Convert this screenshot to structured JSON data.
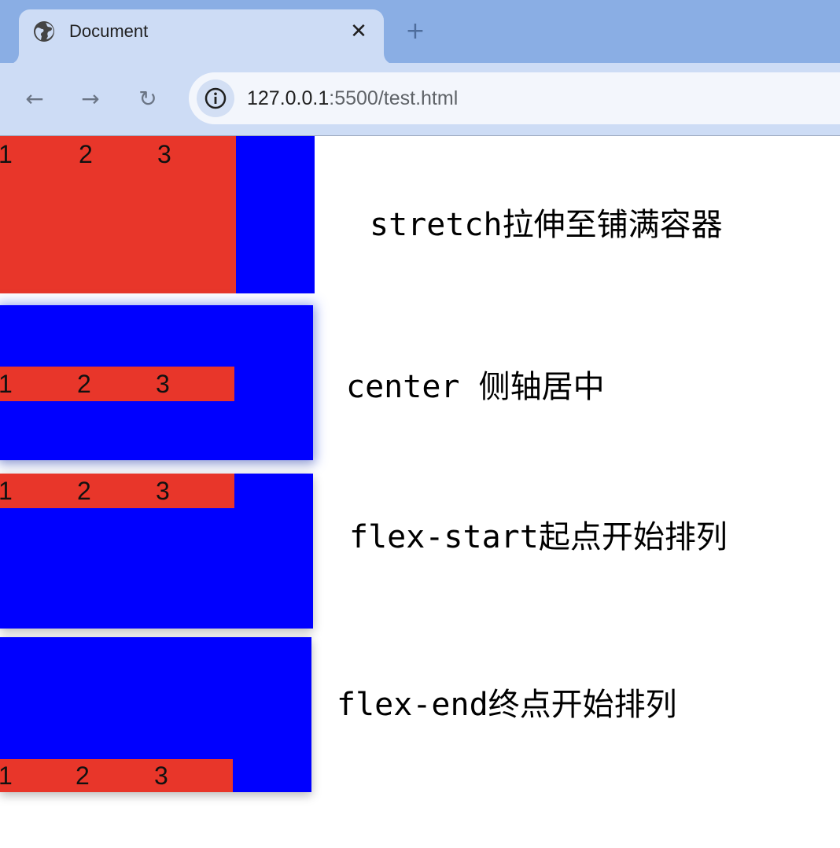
{
  "browser": {
    "tab_title": "Document",
    "tab_icon": "globe-icon",
    "close_glyph": "✕",
    "new_tab_glyph": "+",
    "back_glyph": "←",
    "forward_glyph": "→",
    "reload_glyph": "↻",
    "url_host": "127.0.0.1",
    "url_rest": ":5500/test.html"
  },
  "demos": [
    {
      "name": "stretch",
      "items": [
        "1",
        "2",
        "3"
      ],
      "caption_code": "stretch",
      "caption_text": "拉伸至铺满容器"
    },
    {
      "name": "center",
      "items": [
        "1",
        "2",
        "3"
      ],
      "caption_code": "center ",
      "caption_text": "侧轴居中"
    },
    {
      "name": "flex-start",
      "items": [
        "1",
        "2",
        "3"
      ],
      "caption_code": "flex-start",
      "caption_text": "起点开始排列"
    },
    {
      "name": "flex-end",
      "items": [
        "1",
        "2",
        "3"
      ],
      "caption_code": "flex-end",
      "caption_text": "终点开始排列"
    }
  ],
  "colors": {
    "container": "#0000ff",
    "items": "#e8362a",
    "chrome_tabstrip": "#8aaee4",
    "chrome_toolbar": "#cddcf5"
  }
}
